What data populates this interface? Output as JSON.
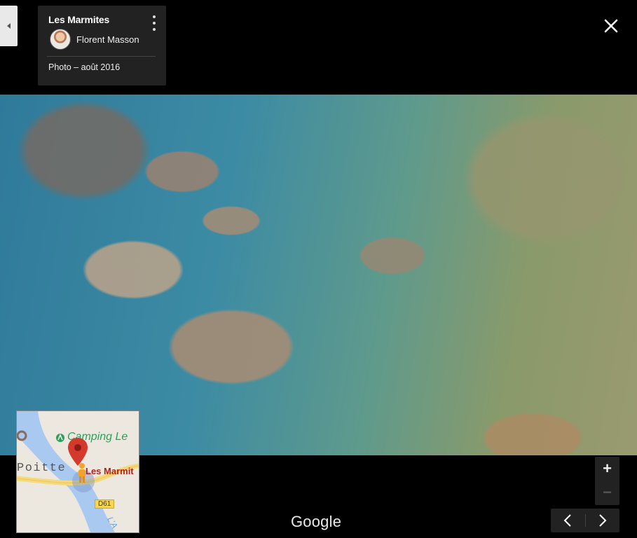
{
  "card": {
    "title": "Les Marmites",
    "author": "Florent Masson",
    "photo_date": "Photo – août 2016"
  },
  "footer": {
    "brand": "Google"
  },
  "minimap": {
    "labels": {
      "camping": "Camping Le",
      "town": "Poitte",
      "place": "Les Marmit",
      "road": "D61",
      "river": "L'A"
    }
  },
  "zoom": {
    "in_label": "+",
    "out_label": "−"
  },
  "icons": {
    "close": "close-icon",
    "menu": "more-vert-icon",
    "collapse": "collapse-left-icon",
    "prev": "chevron-left-icon",
    "next": "chevron-right-icon",
    "pin": "map-pin-icon",
    "pegman": "pegman-icon"
  },
  "colors": {
    "background": "#000000",
    "card": "#222222",
    "pin": "#d33a2c",
    "camping": "#2e9f59",
    "place_label": "#b1221c"
  }
}
